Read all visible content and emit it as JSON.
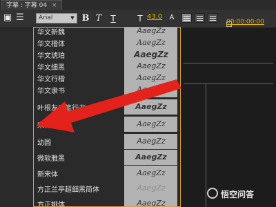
{
  "window": {
    "tab_title": "字幕 : 字幕 04",
    "close": "×"
  },
  "toolbar": {
    "font_name": "Arial",
    "font_size": "43.0",
    "timecode": "00:00:00:00",
    "bold_label": "B",
    "italic_label": "T"
  },
  "font_list": [
    {
      "name": "华文新魏",
      "preview": "AaegZz"
    },
    {
      "name": "华文楷体",
      "preview": "AaegZz"
    },
    {
      "name": "华文琥珀",
      "preview": "AaegZz"
    },
    {
      "name": "华文细黑",
      "preview": "AaegZz"
    },
    {
      "name": "华文行楷",
      "preview": "AaegZz"
    },
    {
      "name": "华文隶书",
      "preview": "AaegZz"
    },
    {
      "name": "叶根友毛笔行书2.0版",
      "preview": "AaegZz"
    },
    {
      "name": "宋体",
      "preview": "AaegZz"
    },
    {
      "name": "幼圆",
      "preview": "AaegZz"
    },
    {
      "name": "微软雅黑",
      "preview": "AaegZz"
    },
    {
      "name": "新宋体",
      "preview": "AaegZz"
    },
    {
      "name": "方正兰亭超细黑简体",
      "preview": "AaegZz"
    },
    {
      "name": "方正姚体",
      "preview": "AaegZz"
    }
  ],
  "watermark": {
    "text": "悟空问答"
  },
  "colors": {
    "accent": "#e6b000",
    "dropdown_border": "#e2a21a",
    "arrow": "#e3231b"
  }
}
